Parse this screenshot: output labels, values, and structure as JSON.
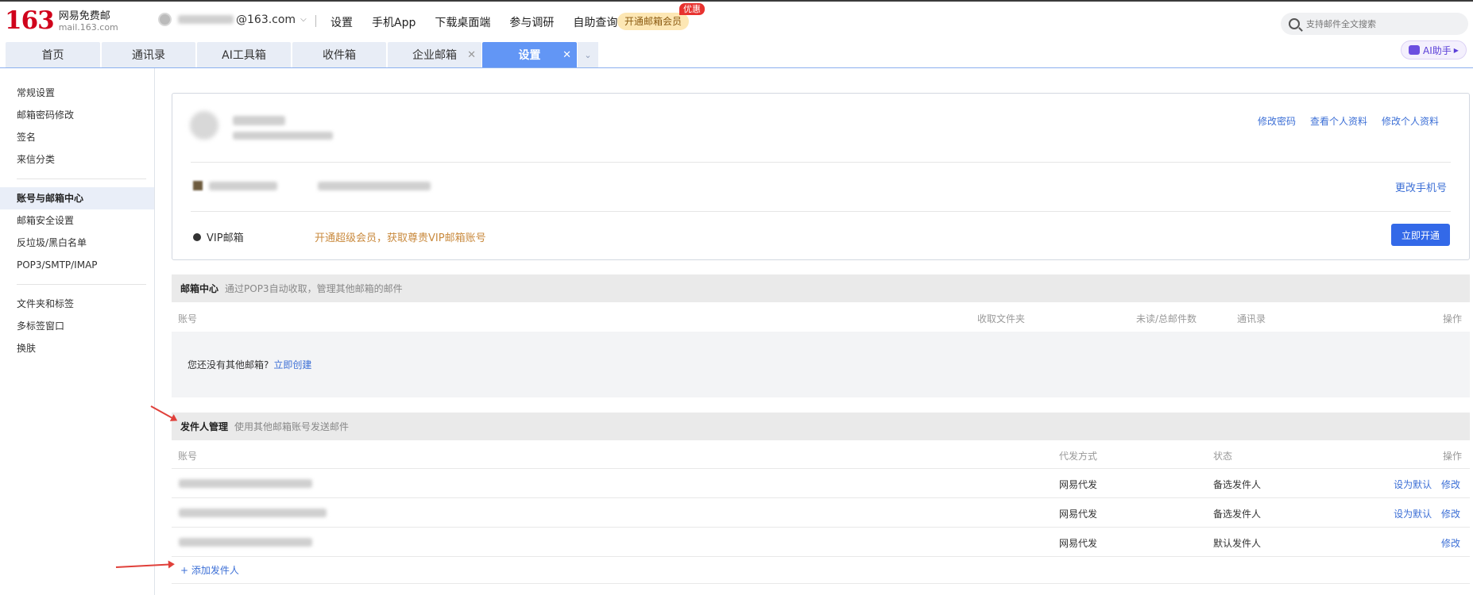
{
  "brand": {
    "logo_number": "163",
    "title": "网易免费邮",
    "domain": "mail.163.com"
  },
  "account": {
    "email_suffix": "@163.com"
  },
  "top_nav": [
    "设置",
    "手机App",
    "下载桌面端",
    "参与调研",
    "自助查询"
  ],
  "vip_promo": {
    "label": "开通邮箱会员",
    "badge": "优惠"
  },
  "search": {
    "placeholder": "支持邮件全文搜索"
  },
  "tabs": [
    {
      "label": "首页"
    },
    {
      "label": "通讯录"
    },
    {
      "label": "AI工具箱"
    },
    {
      "label": "收件箱"
    },
    {
      "label": "企业邮箱"
    },
    {
      "label": "设置"
    }
  ],
  "ai_assistant": {
    "label": "AI助手"
  },
  "sidebar": {
    "group1": [
      "常规设置",
      "邮箱密码修改",
      "签名",
      "来信分类"
    ],
    "group2": [
      "账号与邮箱中心",
      "邮箱安全设置",
      "反垃圾/黑白名单",
      "POP3/SMTP/IMAP"
    ],
    "group3": [
      "文件夹和标签",
      "多标签窗口",
      "换肤"
    ],
    "active": "账号与邮箱中心"
  },
  "profile_card": {
    "links": [
      "修改密码",
      "查看个人资料",
      "修改个人资料"
    ],
    "change_phone": "更改手机号",
    "vip_label": "VIP邮箱",
    "vip_promo": "开通超级会员，获取尊贵VIP邮箱账号",
    "vip_button": "立即开通"
  },
  "mailbox_center": {
    "title": "邮箱中心",
    "desc": "通过POP3自动收取，管理其他邮箱的邮件",
    "columns": [
      "账号",
      "收取文件夹",
      "未读/总邮件数",
      "通讯录",
      "操作"
    ],
    "empty_text": "您还没有其他邮箱?",
    "create_link": "立即创建"
  },
  "sender_mgmt": {
    "title": "发件人管理",
    "desc": "使用其他邮箱账号发送邮件",
    "columns": [
      "账号",
      "代发方式",
      "状态",
      "操作"
    ],
    "rows": [
      {
        "method": "网易代发",
        "status": "备选发件人",
        "set_default": "设为默认",
        "edit": "修改"
      },
      {
        "method": "网易代发",
        "status": "备选发件人",
        "set_default": "设为默认",
        "edit": "修改"
      },
      {
        "method": "网易代发",
        "status": "默认发件人",
        "set_default": "",
        "edit": "修改"
      }
    ],
    "add_link": "+ 添加发件人"
  },
  "colors": {
    "brand_red": "#d0021b",
    "tab_active": "#6296f5",
    "link_blue": "#3c6fd6",
    "vip_button": "#3369e8",
    "promo_gold": "#c98a3e",
    "annotation_red": "#e0403a"
  }
}
